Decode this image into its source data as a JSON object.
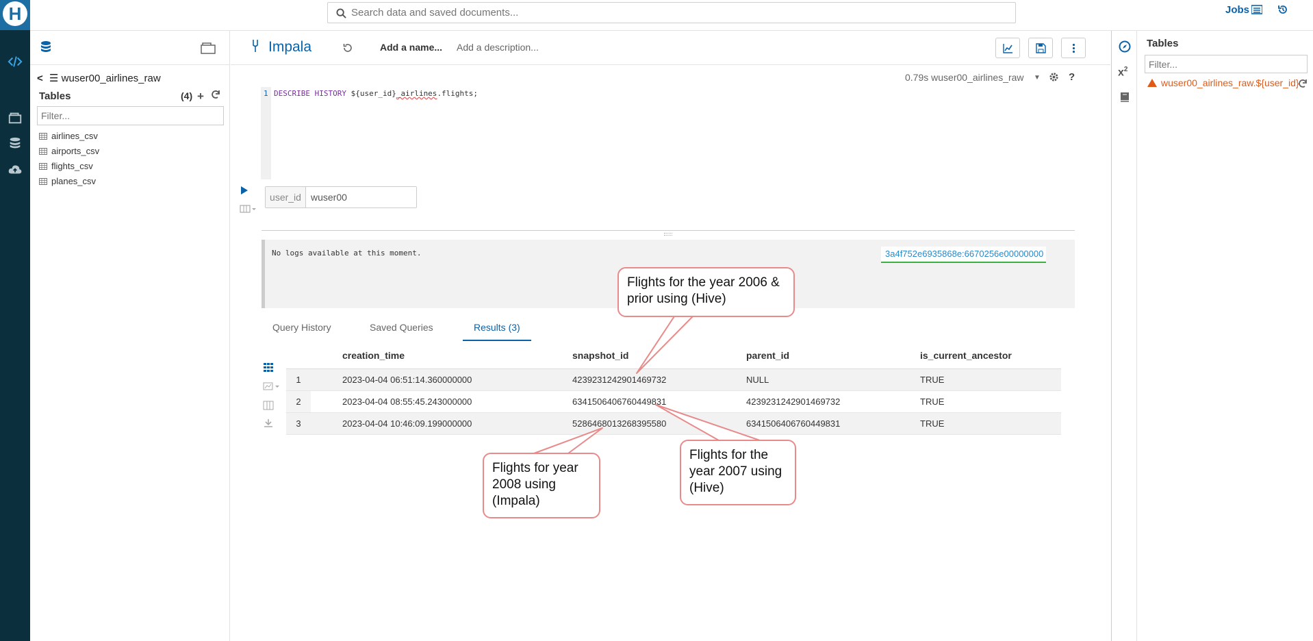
{
  "top": {
    "search_placeholder": "Search data and saved documents...",
    "jobs_label": "Jobs"
  },
  "left_panel": {
    "database": "wuser00_airlines_raw",
    "tables_label": "Tables",
    "tables_count": "(4)",
    "filter_placeholder": "Filter...",
    "tables": [
      {
        "name": "airlines_csv"
      },
      {
        "name": "airports_csv"
      },
      {
        "name": "flights_csv"
      },
      {
        "name": "planes_csv"
      }
    ]
  },
  "editor": {
    "engine": "Impala",
    "add_name": "Add a name...",
    "add_description": "Add a description...",
    "meta": "0.79s wuser00_airlines_raw",
    "line_number": "1",
    "code_kw1": "DESCRIBE",
    "code_kw2": "HISTORY",
    "code_rest1": "${user_id}",
    "code_rest2": "_airlines",
    "code_rest3": ".flights;",
    "param_label": "user_id",
    "param_value": "wuser00"
  },
  "logs": {
    "message": "No logs available at this moment.",
    "query_id": "3a4f752e6935868e:6670256e00000000"
  },
  "tabs": {
    "query_history": "Query History",
    "saved_queries": "Saved Queries",
    "results": "Results (3)"
  },
  "results": {
    "columns": [
      "creation_time",
      "snapshot_id",
      "parent_id",
      "is_current_ancestor"
    ],
    "rows": [
      {
        "n": "1",
        "creation_time": "2023-04-04 06:51:14.360000000",
        "snapshot_id": "4239231242901469732",
        "parent_id": "NULL",
        "is_current_ancestor": "TRUE"
      },
      {
        "n": "2",
        "creation_time": "2023-04-04 08:55:45.243000000",
        "snapshot_id": "6341506406760449831",
        "parent_id": "4239231242901469732",
        "is_current_ancestor": "TRUE"
      },
      {
        "n": "3",
        "creation_time": "2023-04-04 10:46:09.199000000",
        "snapshot_id": "5286468013268395580",
        "parent_id": "6341506406760449831",
        "is_current_ancestor": "TRUE"
      }
    ]
  },
  "right_panel": {
    "title": "Tables",
    "filter_placeholder": "Filter...",
    "warning": "wuser00_airlines_raw.${user_id}"
  },
  "callouts": {
    "c2006": "Flights for the year 2006 & prior using (Hive)",
    "c2008": "Flights for year 2008 using (Impala)",
    "c2007": "Flights for the year 2007 using (Hive)"
  },
  "colors": {
    "accent": "#0a62a8",
    "rail": "#0b2f3c",
    "warning": "#e05a17",
    "callout_border": "#e88a8a"
  }
}
